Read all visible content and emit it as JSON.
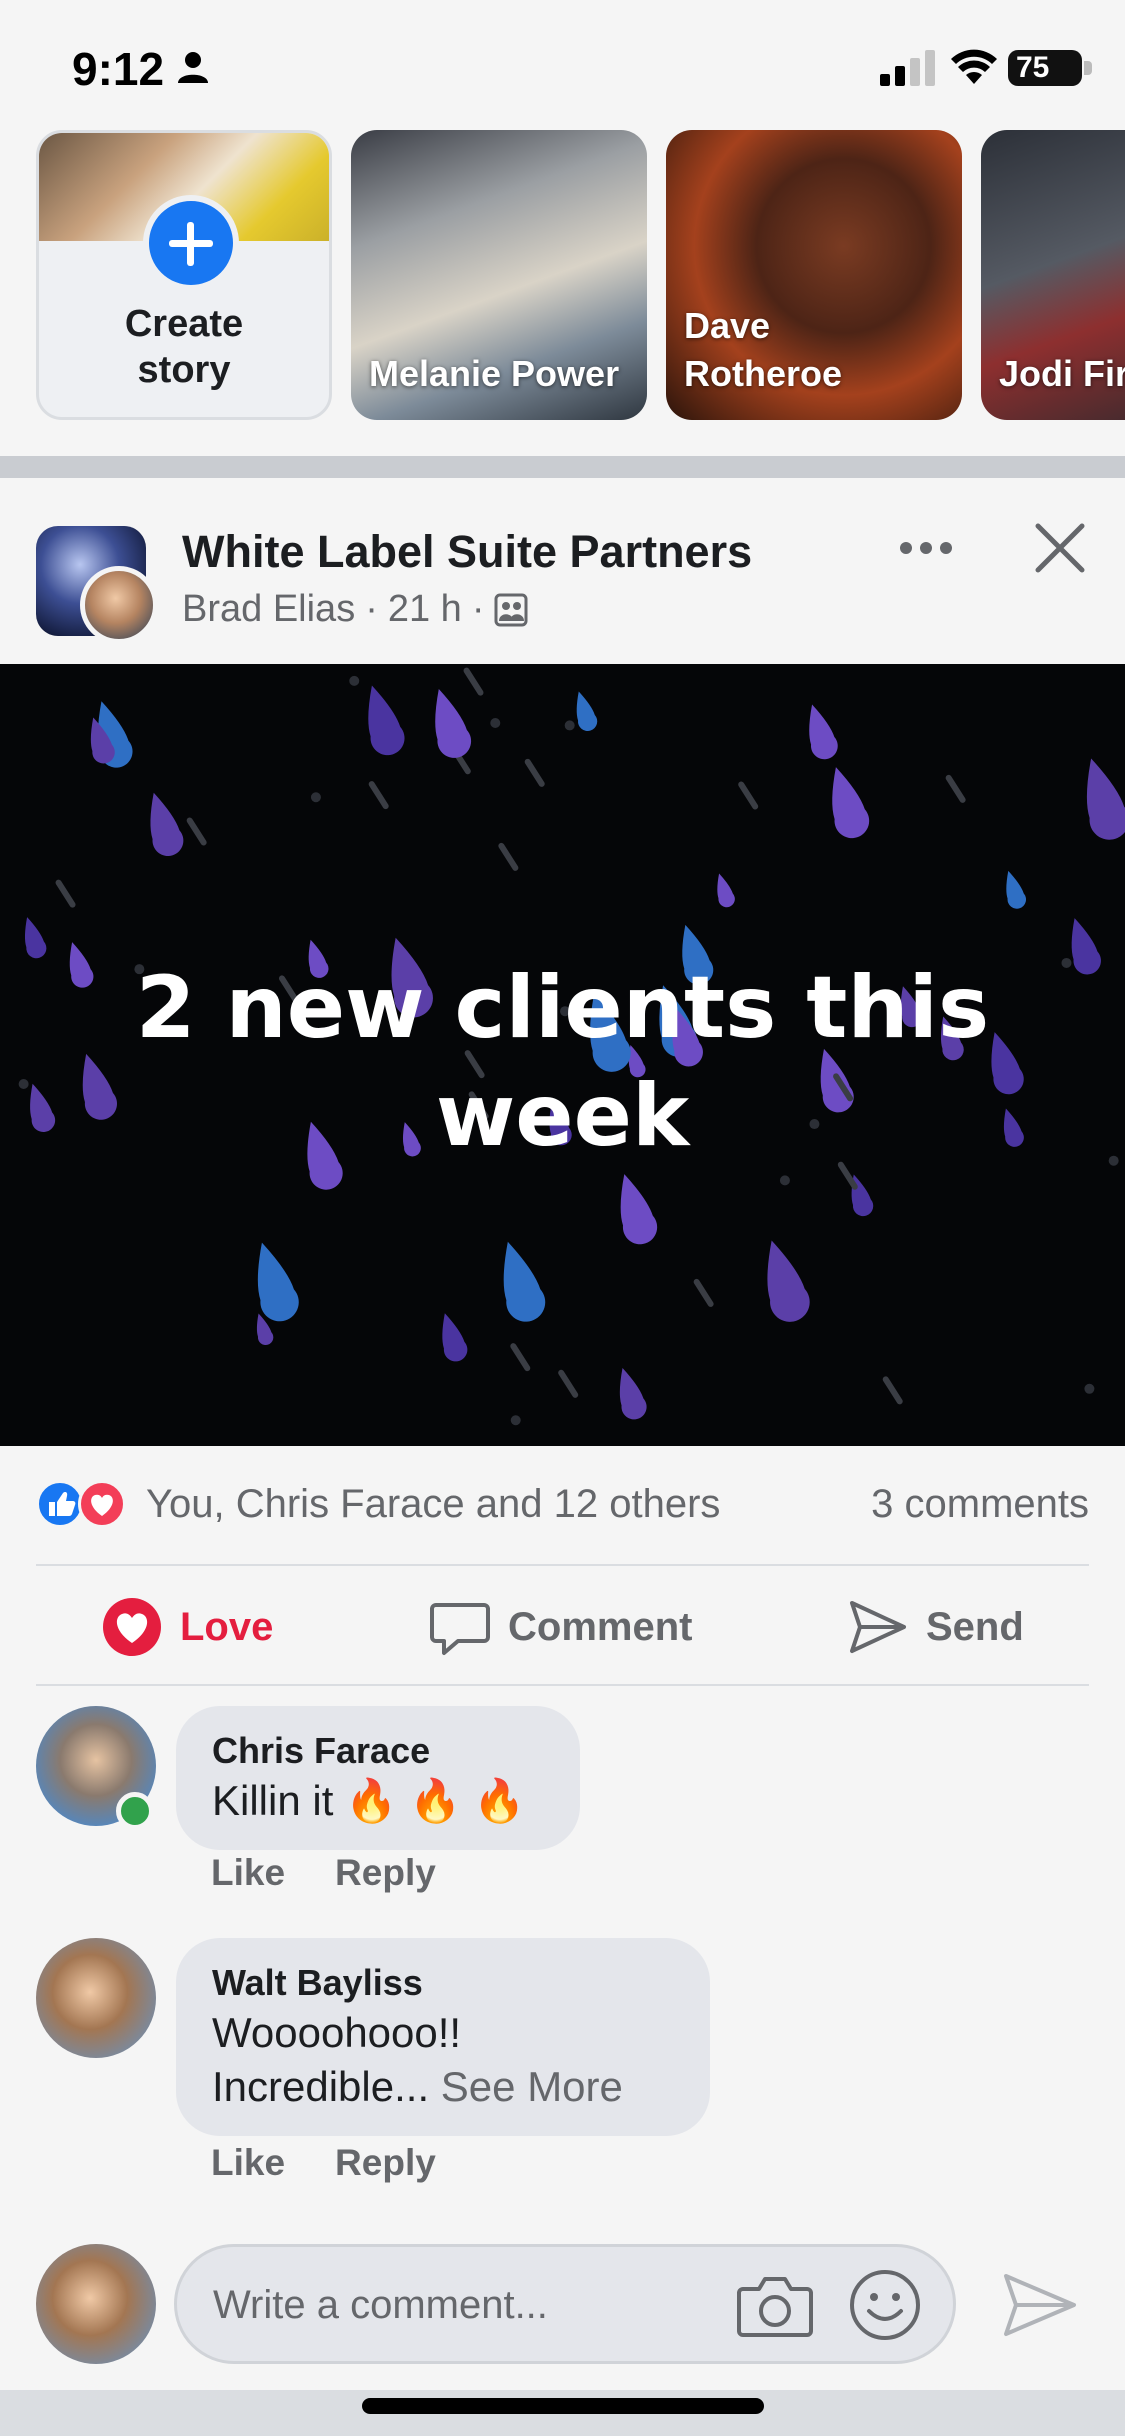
{
  "status_bar": {
    "time": "9:12",
    "battery": "75"
  },
  "stories": {
    "create_label": "Create story",
    "items": [
      {
        "name": "Melanie Power"
      },
      {
        "name": "Dave Rotheroe"
      },
      {
        "name": "Jodi Fir"
      }
    ]
  },
  "post": {
    "title": "White Label Suite Partners",
    "author": "Brad Elias",
    "time": "21 h",
    "image_text": "2 new clients this week",
    "reactions_text": "You, Chris Farace and 12 others",
    "comments_count": "3 comments",
    "actions": {
      "love": "Love",
      "comment": "Comment",
      "send": "Send"
    }
  },
  "comments": [
    {
      "author": "Chris Farace",
      "text": "Killin it 🔥 🔥 🔥",
      "like": "Like",
      "reply": "Reply"
    },
    {
      "author": "Walt Bayliss",
      "text_line1": "Woooohooo!!",
      "text_line2": "Incredible... ",
      "see_more": "See More",
      "like": "Like",
      "reply": "Reply"
    }
  ],
  "write_comment": {
    "placeholder": "Write a comment..."
  },
  "colors": {
    "brand_blue": "#1877f2",
    "love_red": "#e41e3f",
    "secondary_text": "#65676b",
    "bubble_bg": "#e4e6eb"
  }
}
